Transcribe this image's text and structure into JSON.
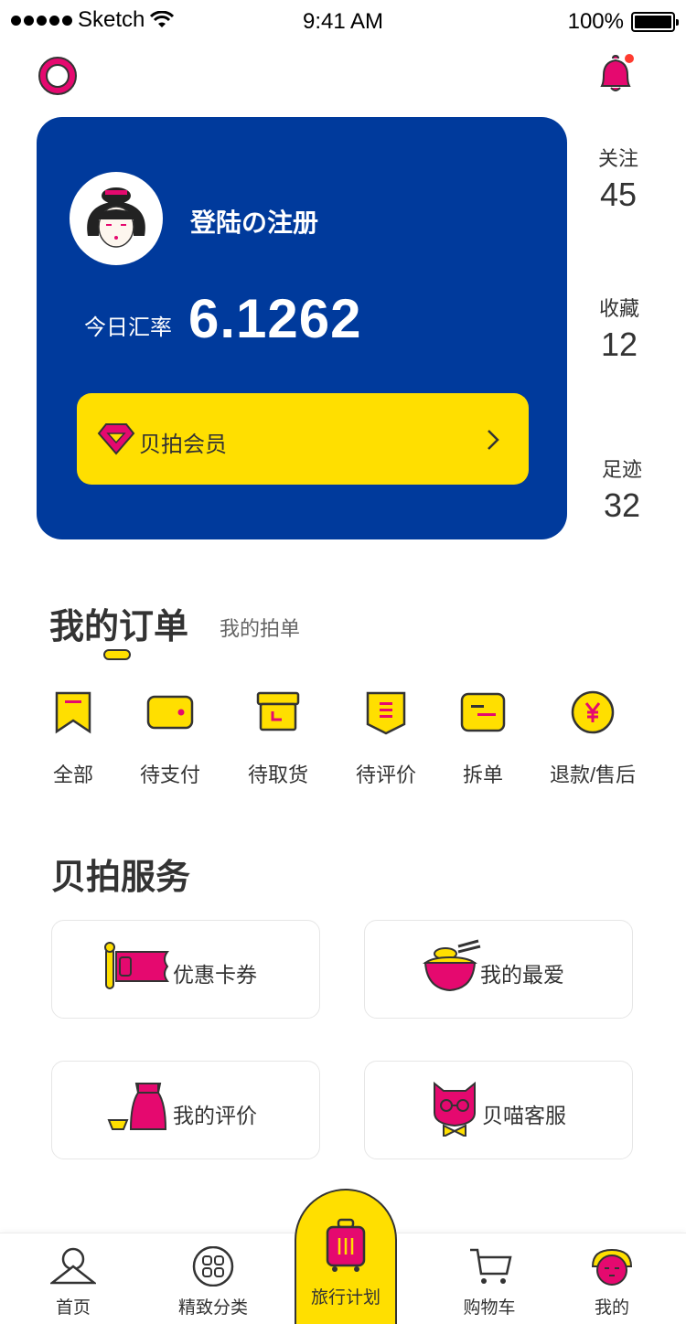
{
  "status_bar": {
    "carrier": "Sketch",
    "time": "9:41 AM",
    "battery": "100%"
  },
  "colors": {
    "brand_blue": "#003a9c",
    "accent_yellow": "#ffdf00",
    "accent_pink": "#e5096f",
    "text": "#333333"
  },
  "header": {
    "left_icon": "ring-icon",
    "right_icon": "bell-icon",
    "has_notification": true
  },
  "profile": {
    "login_label": "登陆の注册",
    "rate_label": "今日汇率",
    "rate_value": "6.1262",
    "member_label": "贝拍会员"
  },
  "stats": [
    {
      "label": "关注",
      "value": "45"
    },
    {
      "label": "收藏",
      "value": "12"
    },
    {
      "label": "足迹",
      "value": "32"
    }
  ],
  "orders": {
    "title": "我的订单",
    "secondary_tab": "我的拍单",
    "items": [
      {
        "label": "全部",
        "icon": "bookmark-icon"
      },
      {
        "label": "待支付",
        "icon": "wallet-icon"
      },
      {
        "label": "待取货",
        "icon": "box-icon"
      },
      {
        "label": "待评价",
        "icon": "review-icon"
      },
      {
        "label": "拆单",
        "icon": "split-icon"
      },
      {
        "label": "退款/售后",
        "icon": "yen-icon"
      }
    ]
  },
  "services": {
    "title": "贝拍服务",
    "items": [
      {
        "label": "优惠卡券",
        "icon": "coupon-icon"
      },
      {
        "label": "我的最爱",
        "icon": "bowl-icon"
      },
      {
        "label": "我的评价",
        "icon": "sake-icon"
      },
      {
        "label": "贝喵客服",
        "icon": "cat-icon"
      }
    ]
  },
  "tab_bar": {
    "items": [
      {
        "label": "首页",
        "icon": "home-mountain-icon"
      },
      {
        "label": "精致分类",
        "icon": "category-icon"
      },
      {
        "label": "旅行计划",
        "icon": "suitcase-icon"
      },
      {
        "label": "购物车",
        "icon": "cart-icon"
      },
      {
        "label": "我的",
        "icon": "profile-face-icon"
      }
    ],
    "active_index": 2
  }
}
